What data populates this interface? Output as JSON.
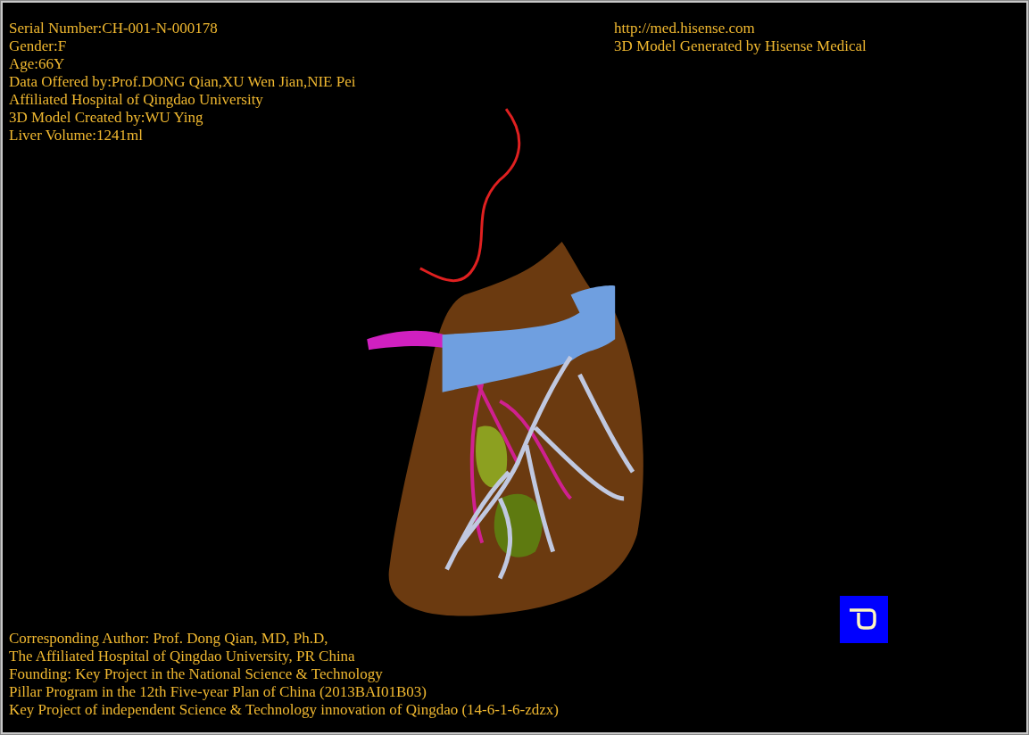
{
  "info": [
    "Serial Number:CH-001-N-000178",
    "Gender:F",
    "Age:66Y",
    "Data Offered by:Prof.DONG Qian,XU Wen Jian,NIE Pei",
    "Affiliated Hospital of Qingdao University",
    "3D Model Created by:WU Ying",
    "Liver Volume:1241ml"
  ],
  "credits": [
    "http://med.hisense.com",
    "3D Model Generated by Hisense Medical"
  ],
  "footer": [
    "Corresponding Author: Prof. Dong Qian, MD, Ph.D,",
    "The Affiliated Hospital of Qingdao University, PR China",
    "Founding: Key Project in the National Science & Technology",
    "Pillar Program in the 12th Five-year Plan of China (2013BAI01B03)",
    "Key Project of independent Science & Technology innovation of Qingdao (14-6-1-6-zdzx)"
  ]
}
